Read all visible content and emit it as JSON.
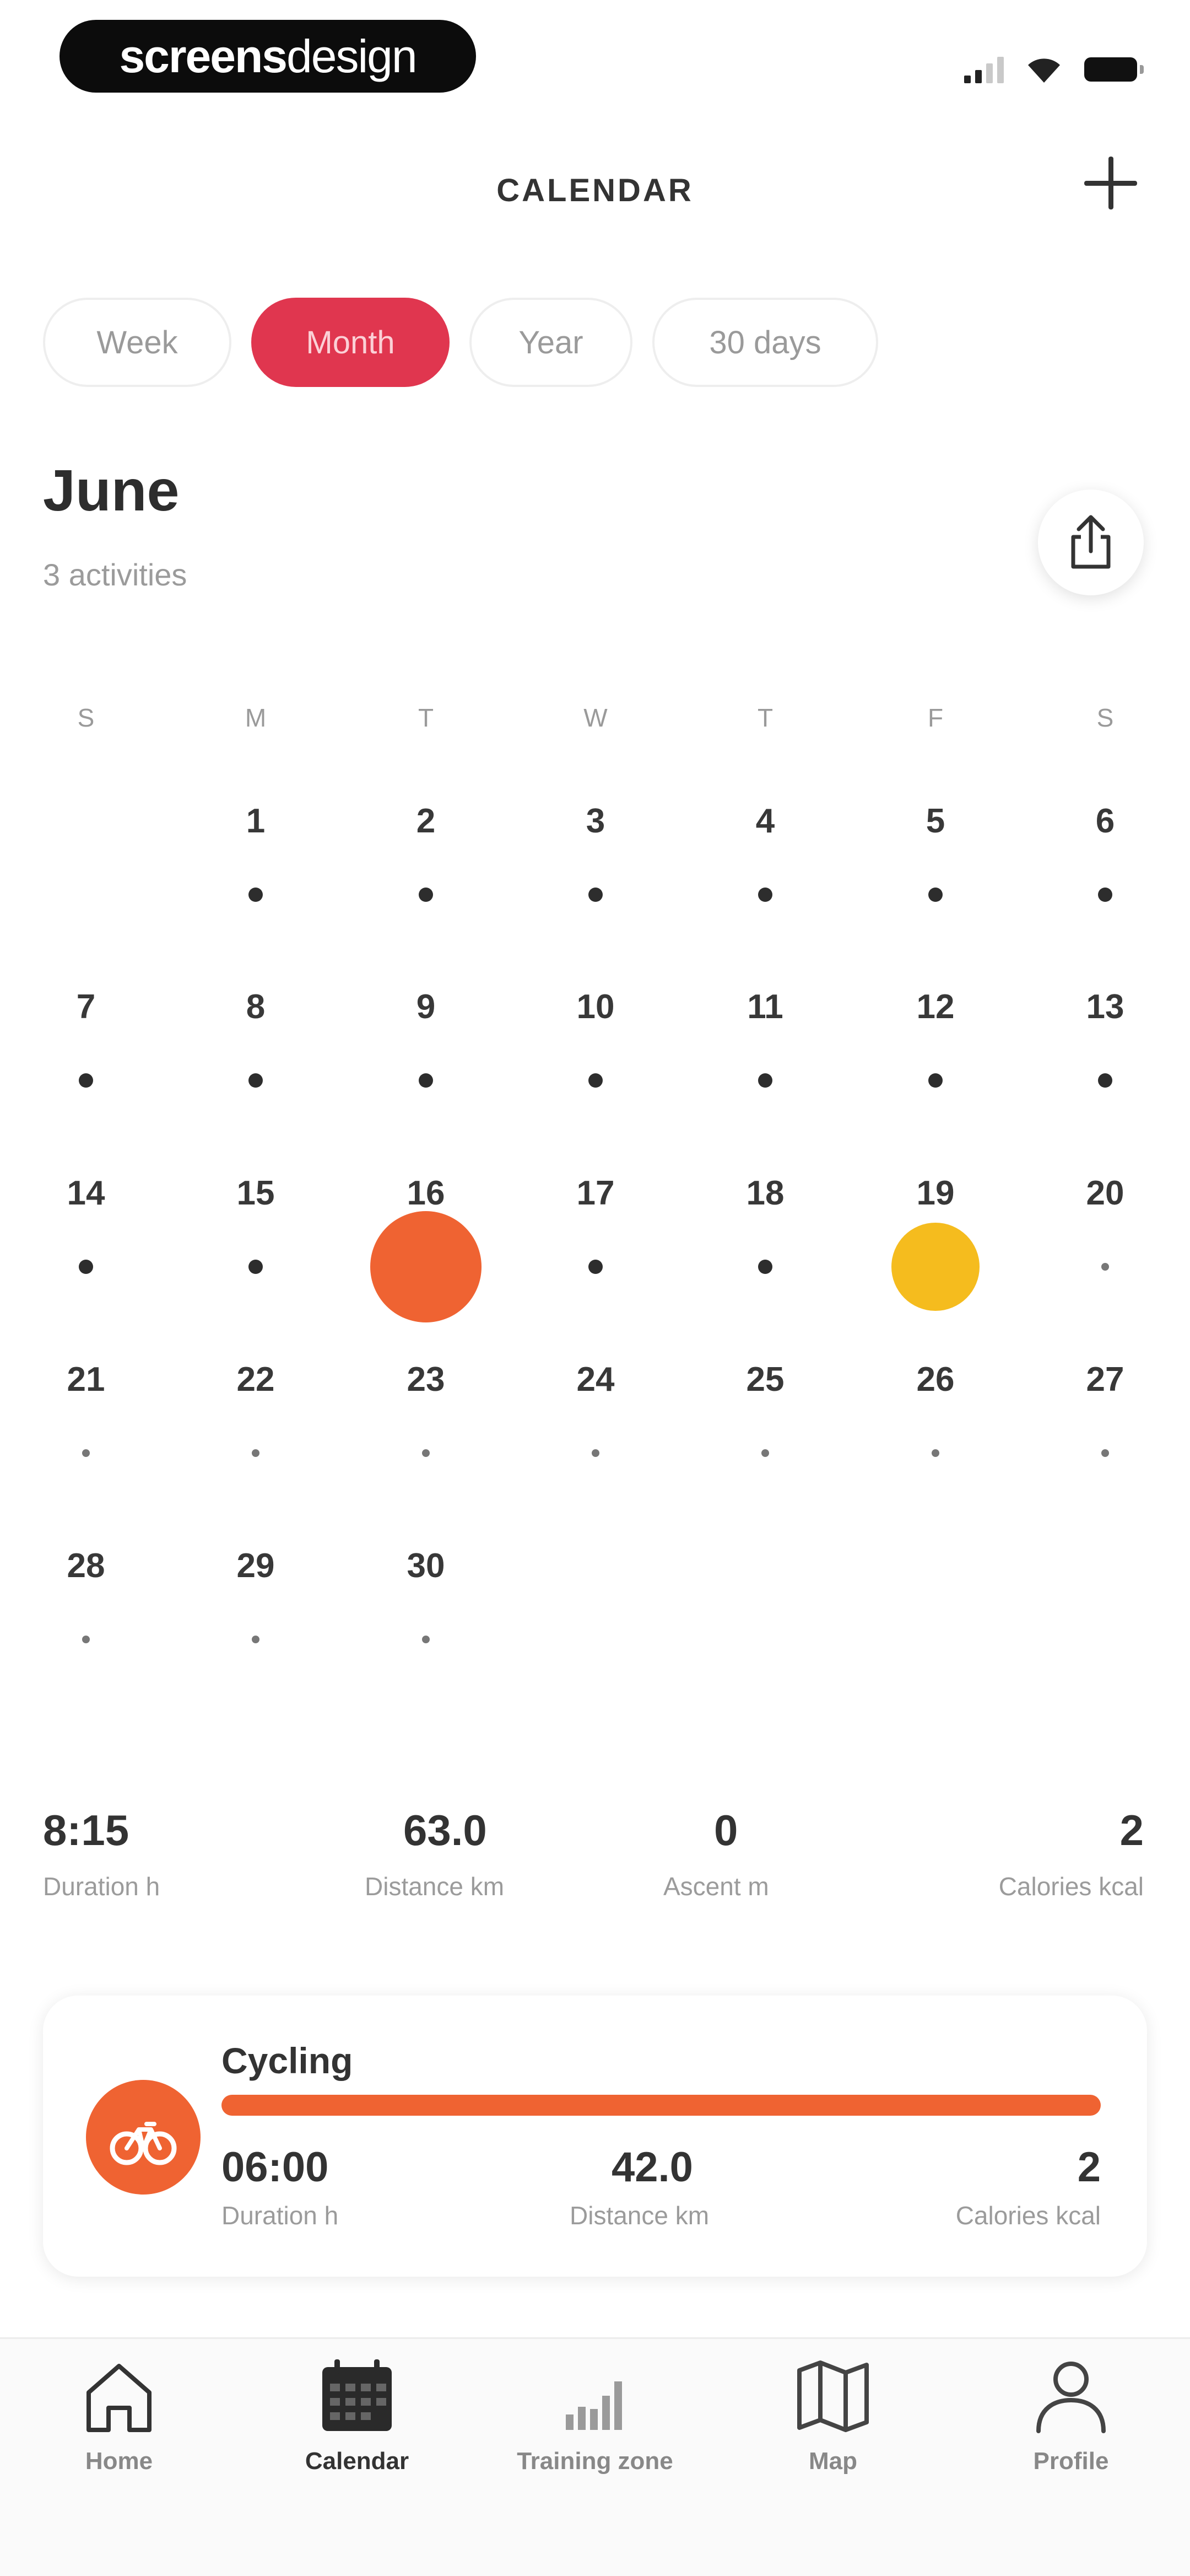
{
  "status_bar": {
    "brand_bold": "screens",
    "brand_light": "design"
  },
  "header": {
    "title": "CALENDAR",
    "add_icon": "plus-icon"
  },
  "tabs": [
    {
      "label": "Week",
      "active": false
    },
    {
      "label": "Month",
      "active": true
    },
    {
      "label": "Year",
      "active": false
    },
    {
      "label": "30 days",
      "active": false
    }
  ],
  "month": {
    "title": "June",
    "subtitle": "3 activities",
    "share_icon": "share-icon"
  },
  "calendar": {
    "weekdays": [
      "S",
      "M",
      "T",
      "W",
      "T",
      "F",
      "S"
    ],
    "weeks": [
      [
        null,
        1,
        2,
        3,
        4,
        5,
        6
      ],
      [
        7,
        8,
        9,
        10,
        11,
        12,
        13
      ],
      [
        14,
        15,
        16,
        17,
        18,
        19,
        20
      ],
      [
        21,
        22,
        23,
        24,
        25,
        26,
        27
      ],
      [
        28,
        29,
        30,
        null,
        null,
        null,
        null
      ]
    ],
    "activity_days": {
      "16": {
        "color": "#ef6332",
        "type": "cycling"
      },
      "19": {
        "color": "#f5bc1e",
        "type": "other"
      }
    },
    "past_until": 19
  },
  "summary": [
    {
      "value": "8:15",
      "label": "Duration h"
    },
    {
      "value": "63.0",
      "label": "Distance km"
    },
    {
      "value": "0",
      "label": "Ascent m"
    },
    {
      "value": "2",
      "label": "Calories kcal"
    }
  ],
  "activity_card": {
    "title": "Cycling",
    "icon": "bicycle-icon",
    "accent": "#ef6332",
    "stats": [
      {
        "value": "06:00",
        "label": "Duration h"
      },
      {
        "value": "42.0",
        "label": "Distance km"
      },
      {
        "value": "2",
        "label": "Calories kcal"
      }
    ]
  },
  "bottom_nav": [
    {
      "label": "Home",
      "icon": "home-icon",
      "active": false
    },
    {
      "label": "Calendar",
      "icon": "calendar-icon",
      "active": true
    },
    {
      "label": "Training zone",
      "icon": "bar-chart-icon",
      "active": false
    },
    {
      "label": "Map",
      "icon": "map-icon",
      "active": false
    },
    {
      "label": "Profile",
      "icon": "person-icon",
      "active": false
    }
  ],
  "colors": {
    "primary": "#e0364f",
    "activity_orange": "#ef6332",
    "activity_yellow": "#f5bc1e"
  }
}
